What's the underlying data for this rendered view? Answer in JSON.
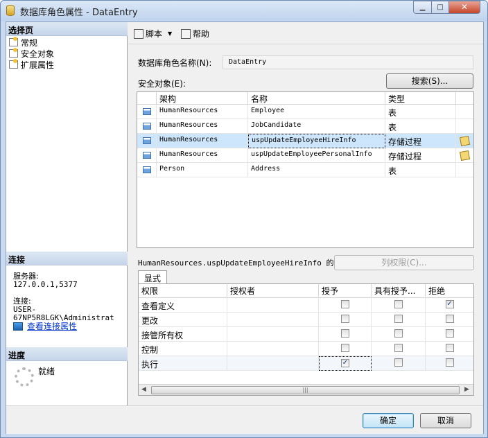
{
  "window": {
    "title": "数据库角色属性 - DataEntry",
    "controls": {
      "minimize": "▁",
      "maximize": "□",
      "close": "✕"
    }
  },
  "left": {
    "select_page_header": "选择页",
    "pages": [
      {
        "label": "常规",
        "icon": "page-icon"
      },
      {
        "label": "安全对象",
        "icon": "page-icon"
      },
      {
        "label": "扩展属性",
        "icon": "page-icon"
      }
    ],
    "connection_header": "连接",
    "server_label": "服务器:",
    "server_value": "127.0.0.1,5377",
    "connect_label": "连接:",
    "connect_value": "USER-67NP5R8LGK\\Administrat",
    "view_connection_link": "查看连接属性",
    "progress_header": "进度",
    "progress_status": "就绪"
  },
  "toolbar": {
    "script_label": "脚本",
    "help_label": "帮助"
  },
  "role_name": {
    "label": "数据库角色名称(N):",
    "value": "DataEntry"
  },
  "securables": {
    "label": "安全对象(E):",
    "search_button": "搜索(S)...",
    "columns": [
      "",
      "架构",
      "名称",
      "类型",
      ""
    ],
    "rows": [
      {
        "schema": "HumanResources",
        "name": "Employee",
        "type": "表",
        "edit": false,
        "selected": false
      },
      {
        "schema": "HumanResources",
        "name": "JobCandidate",
        "type": "表",
        "edit": false,
        "selected": false
      },
      {
        "schema": "HumanResources",
        "name": "uspUpdateEmployeeHireInfo",
        "type": "存储过程",
        "edit": true,
        "selected": true
      },
      {
        "schema": "HumanResources",
        "name": "uspUpdateEmployeePersonalInfo",
        "type": "存储过程",
        "edit": true,
        "selected": false
      },
      {
        "schema": "Person",
        "name": "Address",
        "type": "表",
        "edit": false,
        "selected": false
      }
    ]
  },
  "permissions": {
    "label": "HumanResources.uspUpdateEmployeeHireInfo 的权限(P):",
    "column_permissions_button": "列权限(C)...",
    "tab_explicit": "显式",
    "columns": [
      "权限",
      "授权者",
      "授予",
      "具有授予...",
      "拒绝"
    ],
    "rows": [
      {
        "permission": "查看定义",
        "grantor": "",
        "grant": false,
        "with_grant": false,
        "deny": true
      },
      {
        "permission": "更改",
        "grantor": "",
        "grant": false,
        "with_grant": false,
        "deny": false
      },
      {
        "permission": "接管所有权",
        "grantor": "",
        "grant": false,
        "with_grant": false,
        "deny": false
      },
      {
        "permission": "控制",
        "grantor": "",
        "grant": false,
        "with_grant": false,
        "deny": false
      },
      {
        "permission": "执行",
        "grantor": "",
        "grant": true,
        "with_grant": false,
        "deny": false
      }
    ]
  },
  "buttons": {
    "ok": "确定",
    "cancel": "取消"
  }
}
